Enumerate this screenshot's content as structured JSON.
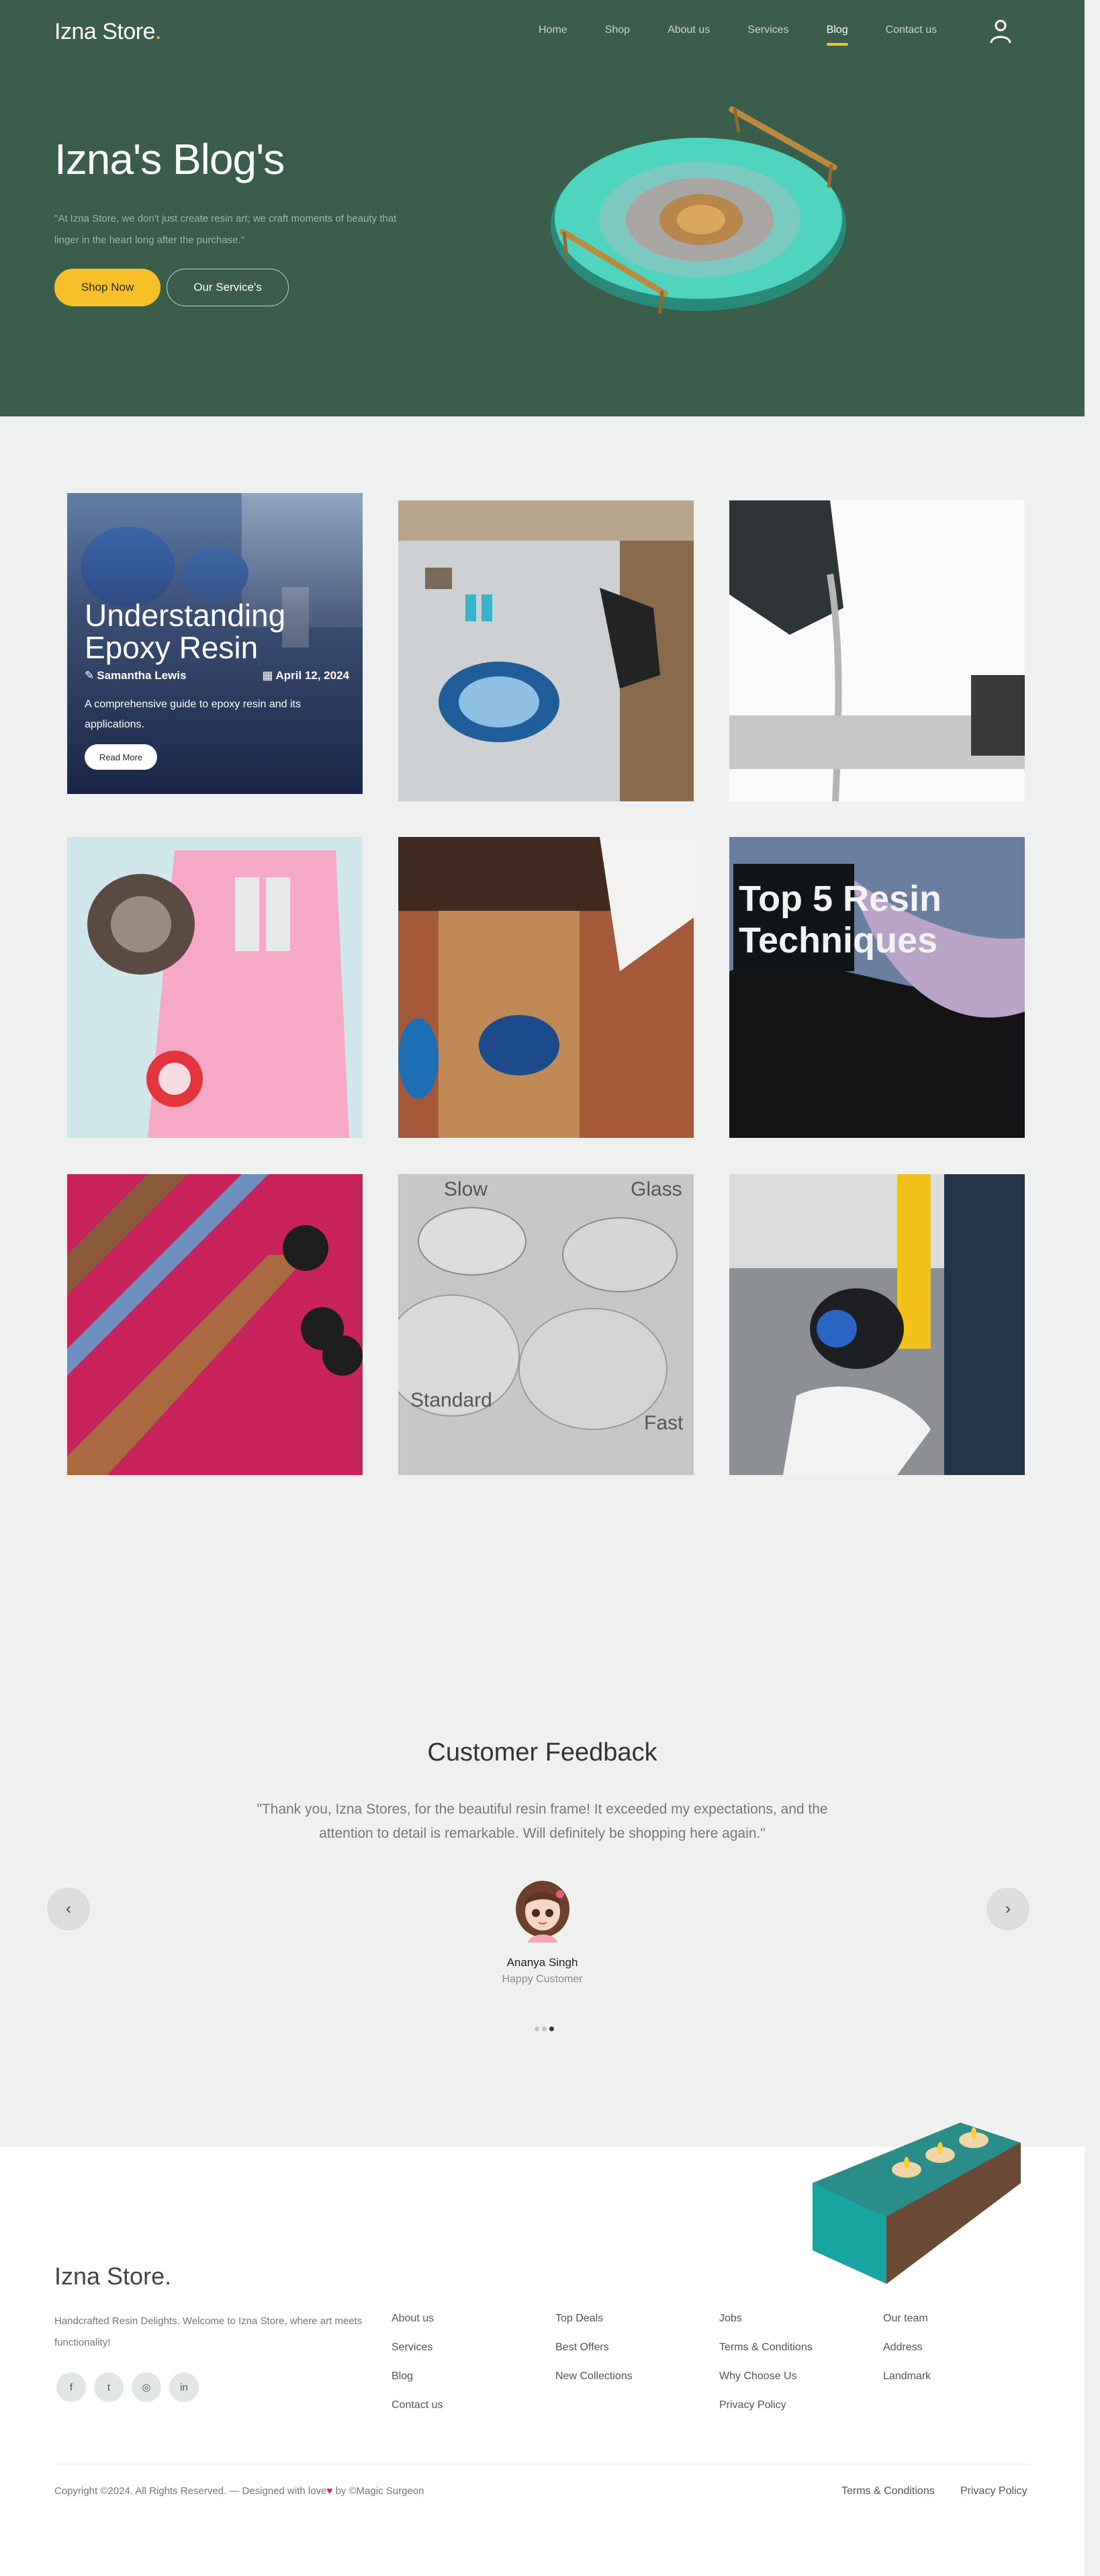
{
  "header": {
    "logo_text": "Izna Store",
    "logo_dot": ".",
    "nav": [
      "Home",
      "Shop",
      "About us",
      "Services",
      "Blog",
      "Contact us"
    ],
    "active_nav": "Blog",
    "user_icon": "user-icon"
  },
  "hero": {
    "title": "Izna's Blog's",
    "text": "\"At Izna Store, we don't just create resin art; we craft moments of beauty that linger in the heart long after the purchase.\"",
    "shop_button": "Shop Now",
    "service_button": "Our Service's"
  },
  "blog": {
    "featured": {
      "title": "Understanding Epoxy Resin",
      "author": "Samantha Lewis",
      "date": "April 12, 2024",
      "description": "A comprehensive guide to epoxy resin and its applications.",
      "button": "Read More"
    },
    "image_texts": {
      "techniques": "Top 5 Resin Techniques",
      "slow": "Slow",
      "glass": "Glass",
      "standard": "Standard",
      "fast": "Fast"
    }
  },
  "feedback": {
    "title": "Customer Feedback",
    "quote": "\"Thank you, Izna Stores, for the beautiful resin frame! It exceeded my expectations, and the attention to detail is remarkable. Will definitely be shopping here again.\"",
    "name": "Ananya Singh",
    "role": "Happy Customer",
    "prev_icon": "chevron-left-icon",
    "next_icon": "chevron-right-icon",
    "prev_glyph": "‹",
    "next_glyph": "›"
  },
  "footer": {
    "logo": "Izna Store.",
    "description": "Handcrafted Resin Delights. Welcome to Izna Store, where art meets functionality!",
    "socials": [
      {
        "name": "facebook-icon",
        "glyph": "f"
      },
      {
        "name": "twitter-icon",
        "glyph": "t"
      },
      {
        "name": "instagram-icon",
        "glyph": "◎"
      },
      {
        "name": "linkedin-icon",
        "glyph": "in"
      }
    ],
    "col1": [
      "About us",
      "Services",
      "Blog",
      "Contact us"
    ],
    "col2": [
      "Top Deals",
      "Best Offers",
      "New Collections"
    ],
    "col3": [
      "Jobs",
      "Terms & Conditions",
      "Why Choose Us",
      "Privacy Policy"
    ],
    "col4": [
      "Our team",
      "Address",
      "Landmark"
    ],
    "copyright_pre": "Copyright ©2024. All Rights Reserved. — Designed with love",
    "copyright_heart": "♥",
    "copyright_post": " by ©Magic Surgeon",
    "terms": "Terms & Conditions",
    "privacy": "Privacy Policy"
  },
  "colors": {
    "hero_bg": "#3b5d4c",
    "accent": "#f6c029",
    "page_bg": "#eff1f0"
  }
}
